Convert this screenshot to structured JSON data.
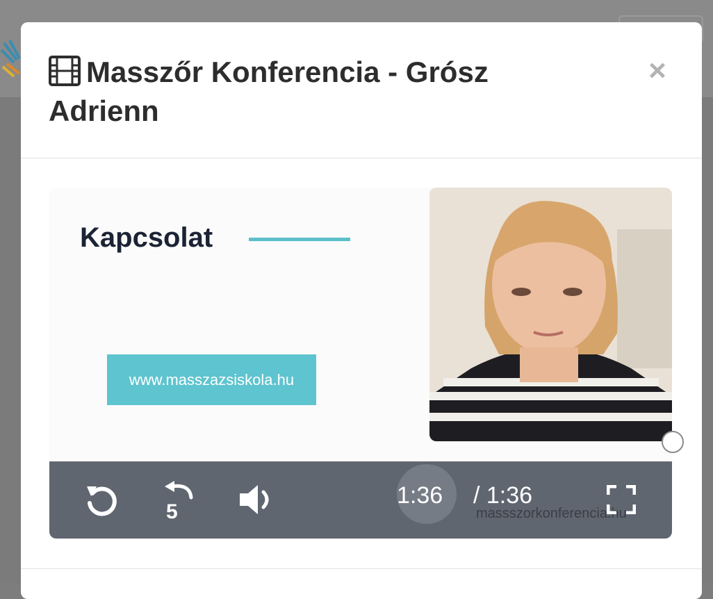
{
  "modal": {
    "title": "Masszőr Konferencia - Grósz Adrienn",
    "close_label": "×"
  },
  "video": {
    "slide_heading": "Kapcsolat",
    "slide_url": "www.masszazsiskola.hu",
    "current_time": "1:36",
    "duration": "/ 1:36",
    "watermark": "massszorkonferencia.hu",
    "progress": 1.0
  },
  "icons": {
    "title": "film-icon",
    "close": "close-icon",
    "replay": "replay-icon",
    "rewind": "rewind-5-icon",
    "volume": "volume-icon",
    "fullscreen": "fullscreen-icon"
  },
  "colors": {
    "accent": "#5ec4cf",
    "controls_bg": "#5f6670",
    "title_text": "#2d2d2d"
  }
}
